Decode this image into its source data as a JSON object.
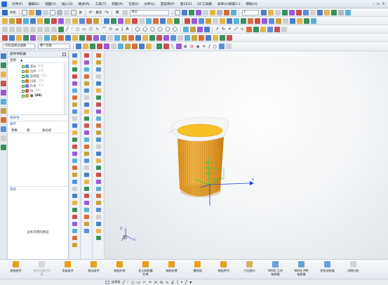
{
  "menubar": {
    "items": [
      "文件(F)",
      "编辑(E)",
      "视图(V)",
      "插入(S)",
      "格式(R)",
      "工具(T)",
      "装配(A)",
      "信息(I)",
      "分析(L)",
      "首选项(P)",
      "窗口(O)",
      "GC工具箱",
      "表单(U)视窗2.1",
      "帮助(H)"
    ]
  },
  "toolbar1": {
    "start_label": "开始",
    "undo_label": "撤消",
    "direction_combo": "体方",
    "number_combo": "1"
  },
  "toolbar2": {},
  "toolbar3": {},
  "toolbar4": {
    "filter_combo": "没有选择过滤器",
    "assembly_combo": "整个装配"
  },
  "navigator": {
    "title": "部件导航器",
    "column_name": "名称",
    "rows": [
      {
        "label": "基准",
        "count": "(11)",
        "color": "#5a8fd6",
        "bold": false
      },
      {
        "label": "拉伸",
        "count": "(14)",
        "color": "#c8a23a",
        "bold": false
      },
      {
        "label": "面倒圆",
        "count": "(15)",
        "color": "#5ab0d6",
        "bold": false
      },
      {
        "label": "扫掠",
        "count": "(16)",
        "color": "#d66f3a",
        "bold": false
      },
      {
        "label": "片体",
        "count": "(17)",
        "color": "#7a7ad6",
        "bold": false
      },
      {
        "label": "体",
        "count": "(19)",
        "color": "#c85050",
        "bold": false
      },
      {
        "label": "体",
        "count": "(20)",
        "color": "#c8a23a",
        "bold": true
      }
    ],
    "dependency_label": "相依性",
    "details_label": "细节",
    "param_columns": [
      "参数",
      "值",
      "表达式"
    ],
    "preview_label": "预览",
    "preview_message": "没有可用的预览"
  },
  "bottombar": {
    "items": [
      {
        "label": "查找组件",
        "icon_color": "#e3a21a",
        "dim": false
      },
      {
        "label": "按邻近度打开\n组",
        "icon_color": "#d8d8d8",
        "dim": true
      },
      {
        "label": "添加组件",
        "icon_color": "#e3a21a",
        "dim": false
      },
      {
        "label": "移动组件",
        "icon_color": "#e3a21a",
        "dim": false
      },
      {
        "label": "装配约束",
        "icon_color": "#e3a21a",
        "dim": false
      },
      {
        "label": "显示和隐藏\n约束",
        "icon_color": "#e3a21a",
        "dim": false
      },
      {
        "label": "装配布置",
        "icon_color": "#e3a21a",
        "dim": false
      },
      {
        "label": "爆炸图",
        "icon_color": "#e3a21a",
        "dim": false
      },
      {
        "label": "装配序列",
        "icon_color": "#e3a21a",
        "dim": false
      },
      {
        "label": "产品接口",
        "icon_color": "#d6b25a",
        "dim": false
      },
      {
        "label": "WAVE 几何\n链接器",
        "icon_color": "#6aa0d6",
        "dim": false
      },
      {
        "label": "WAVE PMI\n链接器",
        "icon_color": "#6aa0d6",
        "dim": false
      },
      {
        "label": "关系浏览器",
        "icon_color": "#6aa0d6",
        "dim": false
      },
      {
        "label": "间隙分析",
        "icon_color": "#d6d6d6",
        "dim": false
      }
    ]
  },
  "statusbar": {
    "snap_label": "选择条"
  },
  "model": {
    "body_color": "#e9a93a",
    "rim_color": "#f2f2f2",
    "top_face_color": "#f6c026",
    "wcs_color": "#2ecc40",
    "axis_x_color": "#1f3fd6"
  }
}
